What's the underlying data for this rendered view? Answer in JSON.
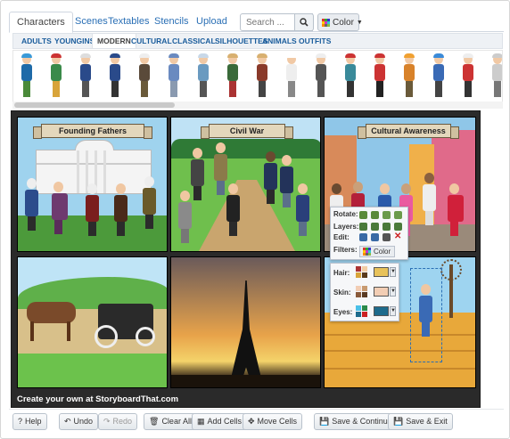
{
  "tabs": [
    "Characters",
    "Scenes",
    "Textables",
    "Stencils",
    "Upload"
  ],
  "search": {
    "placeholder": "Search ..."
  },
  "color_button": {
    "label": "Color"
  },
  "categories": [
    "ADULTS",
    "YOUNGINS",
    "MODERN",
    "CULTURAL",
    "CLASSICAL",
    "SILHOUETTES",
    "ANIMALS",
    "OUTFITS"
  ],
  "active_category": "MODERN",
  "cells": [
    {
      "title": "Founding Fathers"
    },
    {
      "title": "Civil War"
    },
    {
      "title": "Cultural Awareness"
    },
    {
      "title": ""
    },
    {
      "title": ""
    },
    {
      "title": ""
    }
  ],
  "caption": "Create your own at StoryboardThat.com",
  "popup": {
    "rows": [
      "Rotate:",
      "Layers:",
      "Edit:",
      "Filters:"
    ],
    "filter_color": "Color",
    "props": [
      "Hair:",
      "Skin:",
      "Eyes:"
    ],
    "prop_colors": [
      "#e8c25a",
      "#f2cdb4",
      "#1e6b8c"
    ]
  },
  "toolbar": {
    "help": "Help",
    "undo": "Undo",
    "redo": "Redo",
    "clear_all": "Clear All",
    "add_cells": "Add Cells",
    "move_cells": "Move Cells",
    "save_continue": "Save & Continue",
    "save_exit": "Save & Exit"
  },
  "colors": {
    "link": "#2a6fb5",
    "accent": "#1b5d9c",
    "board_bg": "#2a2a2a"
  }
}
